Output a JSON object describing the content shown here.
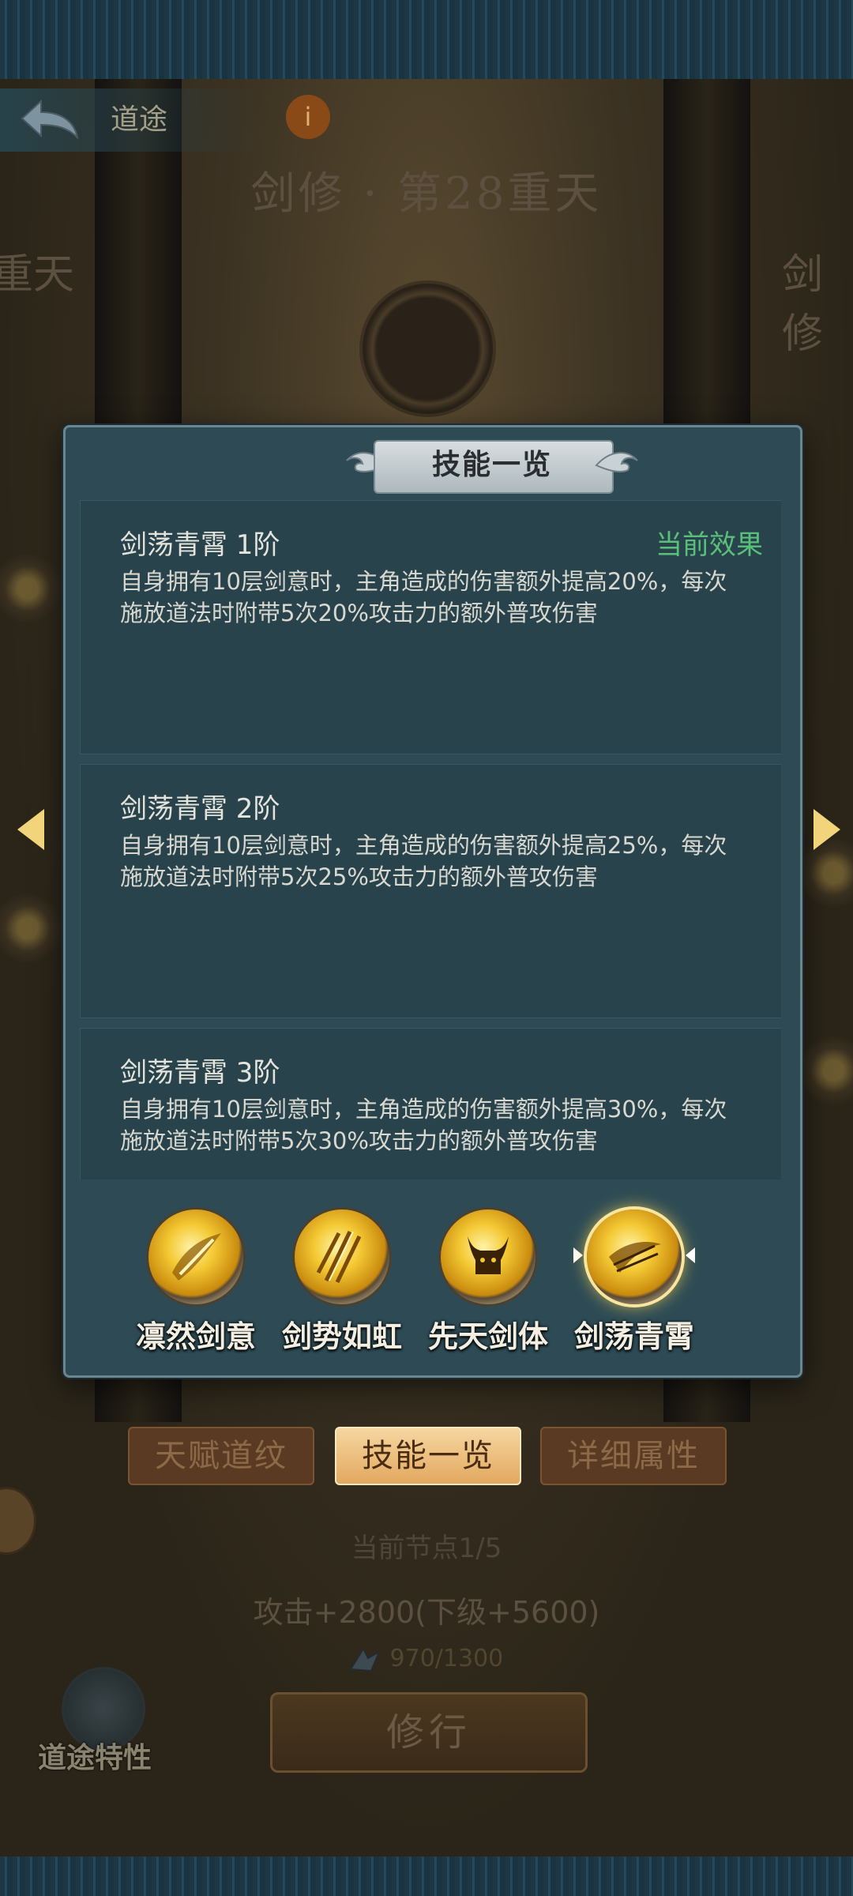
{
  "header": {
    "back_label": "道途",
    "info_icon": "i",
    "realm_title": "剑修 · 第28重天",
    "left_side_title": "重天",
    "right_side_title": "剑修"
  },
  "modal": {
    "title": "技能一览",
    "skills": [
      {
        "name": "剑荡青霄 1阶",
        "effect_label": "当前效果",
        "description": "自身拥有10层剑意时，主角造成的伤害额外提高20%，每次施放道法时附带5次20%攻击力的额外普攻伤害"
      },
      {
        "name": "剑荡青霄 2阶",
        "effect_label": "",
        "description": "自身拥有10层剑意时，主角造成的伤害额外提高25%，每次施放道法时附带5次25%攻击力的额外普攻伤害"
      },
      {
        "name": "剑荡青霄 3阶",
        "effect_label": "",
        "description": "自身拥有10层剑意时，主角造成的伤害额外提高30%，每次施放道法时附带5次30%攻击力的额外普攻伤害"
      }
    ],
    "skill_tabs": [
      {
        "label": "凛然剑意",
        "icon": "sword-swirl-icon"
      },
      {
        "label": "剑势如虹",
        "icon": "sword-rain-icon"
      },
      {
        "label": "先天剑体",
        "icon": "horned-demon-icon"
      },
      {
        "label": "剑荡青霄",
        "icon": "sword-slash-icon"
      }
    ]
  },
  "bottom": {
    "tabs": [
      "天赋道纹",
      "技能一览",
      "详细属性"
    ],
    "node_text": "当前节点1/5",
    "attack_text": "攻击+2800(下级+5600)",
    "progress": "970/1300",
    "cultivate_label": "修行",
    "trait_label": "道途特性"
  },
  "colors": {
    "modal_bg": "#2e4b55",
    "current_effect": "#59c07a",
    "tab_active": "#e2a860"
  }
}
